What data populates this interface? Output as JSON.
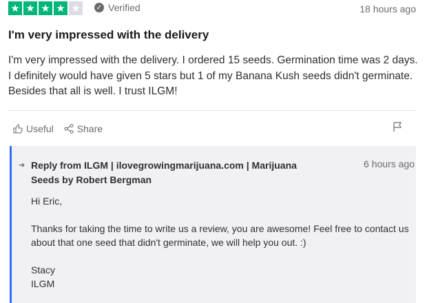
{
  "review": {
    "rating": 4,
    "max_rating": 5,
    "star_char": "★",
    "verified_label": "Verified",
    "check_glyph": "✓",
    "time_ago": "18 hours ago",
    "title": "I'm very impressed with the delivery",
    "body": "I'm very impressed with the delivery. I ordered 15 seeds. Germination time was 2 days. I definitely would have given 5 stars but 1 of my Banana Kush seeds didn't germinate. Besides that all is well. I trust ILGM!"
  },
  "actions": {
    "useful_label": "Useful",
    "share_label": "Share",
    "useful_icon": "thumbs-up-icon",
    "share_icon": "share-icon",
    "flag_icon": "flag-icon"
  },
  "reply": {
    "arrow_glyph": "➜",
    "title": "Reply from ILGM | ilovegrowingmarijuana.com | Marijuana Seeds by Robert Bergman",
    "time_ago": "6 hours ago",
    "greeting": "Hi Eric,",
    "message": "Thanks for taking the time to write us a review, you are awesome! Feel free to contact us about that one seed that didn't germinate, we will help you out. :)",
    "sign_name": "Stacy",
    "sign_company": "ILGM"
  },
  "colors": {
    "star_on": "#00b67a",
    "star_off": "#dcdce6",
    "reply_border": "#2f6cf6",
    "reply_bg": "#f1f1f5"
  }
}
